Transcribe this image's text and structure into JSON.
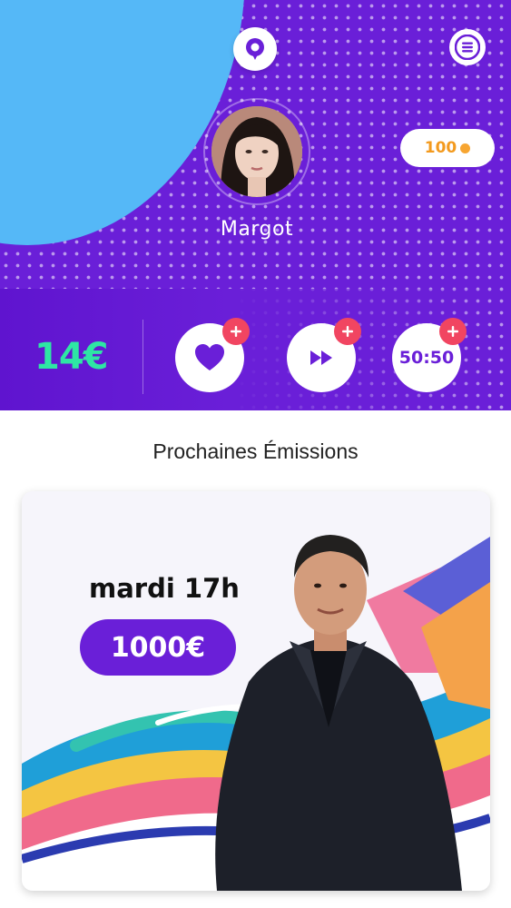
{
  "profile": {
    "name": "Margot",
    "coins": "100",
    "balance": "14€"
  },
  "jokers": [
    {
      "type": "heart",
      "label": ""
    },
    {
      "type": "skip",
      "label": ""
    },
    {
      "type": "fifty-fifty",
      "label": "50:50"
    }
  ],
  "icons": {
    "logo": "q-speech-bubble-icon",
    "menu": "hamburger-menu-icon",
    "coin": "coin-icon",
    "plus": "plus-icon",
    "heart": "heart-icon",
    "skip": "fast-forward-icon"
  },
  "upcoming": {
    "title": "Prochaines Émissions",
    "shows": [
      {
        "day": "mardi 17h",
        "prize": "1000€"
      }
    ]
  },
  "colors": {
    "primary": "#6a1fd8",
    "sky": "#55b8f7",
    "money": "#2ee6a4",
    "coin": "#f39a1e",
    "plus": "#f14561"
  }
}
